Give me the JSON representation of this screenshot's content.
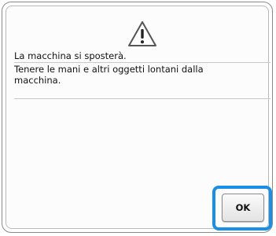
{
  "dialog": {
    "icon": "warning-triangle-icon",
    "messages": [
      "La macchina si sposterà.",
      "Tenere le mani e altri oggetti lontani dalla\nmacchina."
    ],
    "ok_label": "OK"
  },
  "colors": {
    "highlight": "#1a8fe6",
    "border": "#8a8a8a",
    "text": "#111111"
  }
}
